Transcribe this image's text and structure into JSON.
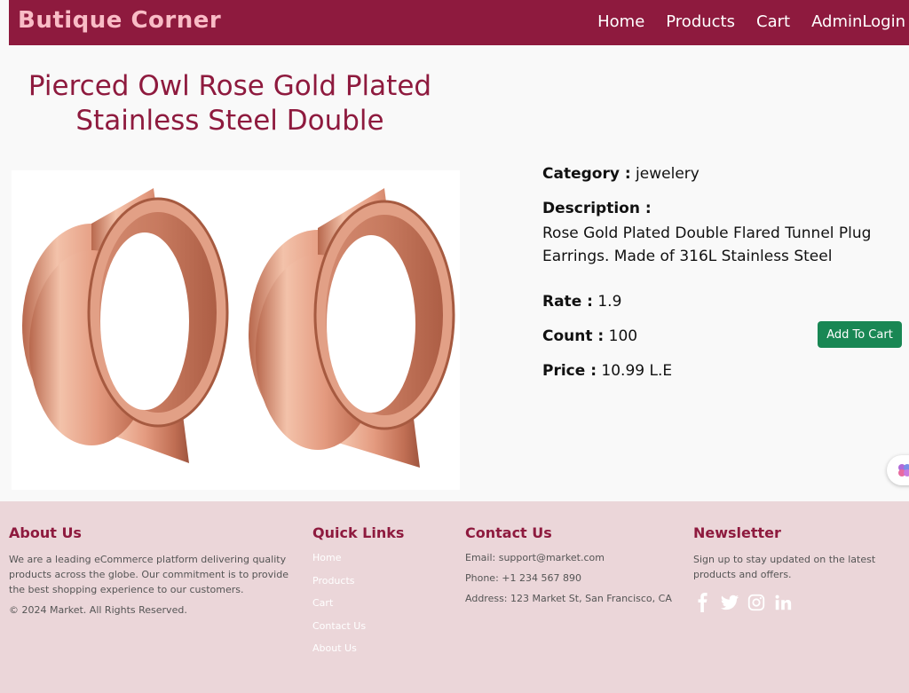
{
  "navbar": {
    "brand": "Butique Corner",
    "links": [
      "Home",
      "Products",
      "Cart",
      "AdminLogin"
    ]
  },
  "product": {
    "title": "Pierced Owl Rose Gold Plated Stainless Steel Double",
    "category_label": "Category :",
    "category": "jewelery",
    "description_label": "Description :",
    "description": "Rose Gold Plated Double Flared Tunnel Plug Earrings. Made of 316L Stainless Steel",
    "rate_label": "Rate :",
    "rate": "1.9",
    "count_label": "Count :",
    "count": "100",
    "price_label": "Price :",
    "price": "10.99 L.E",
    "add_to_cart": "Add To Cart"
  },
  "footer": {
    "about": {
      "heading": "About Us",
      "text": "We are a leading eCommerce platform delivering quality products across the globe. Our commitment is to provide the best shopping experience to our customers.",
      "copyright": "© 2024 Market. All Rights Reserved."
    },
    "quick_links": {
      "heading": "Quick Links",
      "items": [
        "Home",
        "Products",
        "Cart",
        "Contact Us",
        "About Us"
      ]
    },
    "contact": {
      "heading": "Contact Us",
      "email": "Email: support@market.com",
      "phone": "Phone: +1 234 567 890",
      "address": "Address: 123 Market St, San Francisco, CA"
    },
    "newsletter": {
      "heading": "Newsletter",
      "text": "Sign up to stay updated on the latest products and offers.",
      "social_icons": [
        "facebook-icon",
        "twitter-icon",
        "instagram-icon",
        "linkedin-icon"
      ]
    }
  },
  "colors": {
    "brand": "#8e1a3e",
    "brand_text": "#f9bcc6",
    "footer_bg": "#ebd6d9",
    "button_green": "#198754"
  }
}
